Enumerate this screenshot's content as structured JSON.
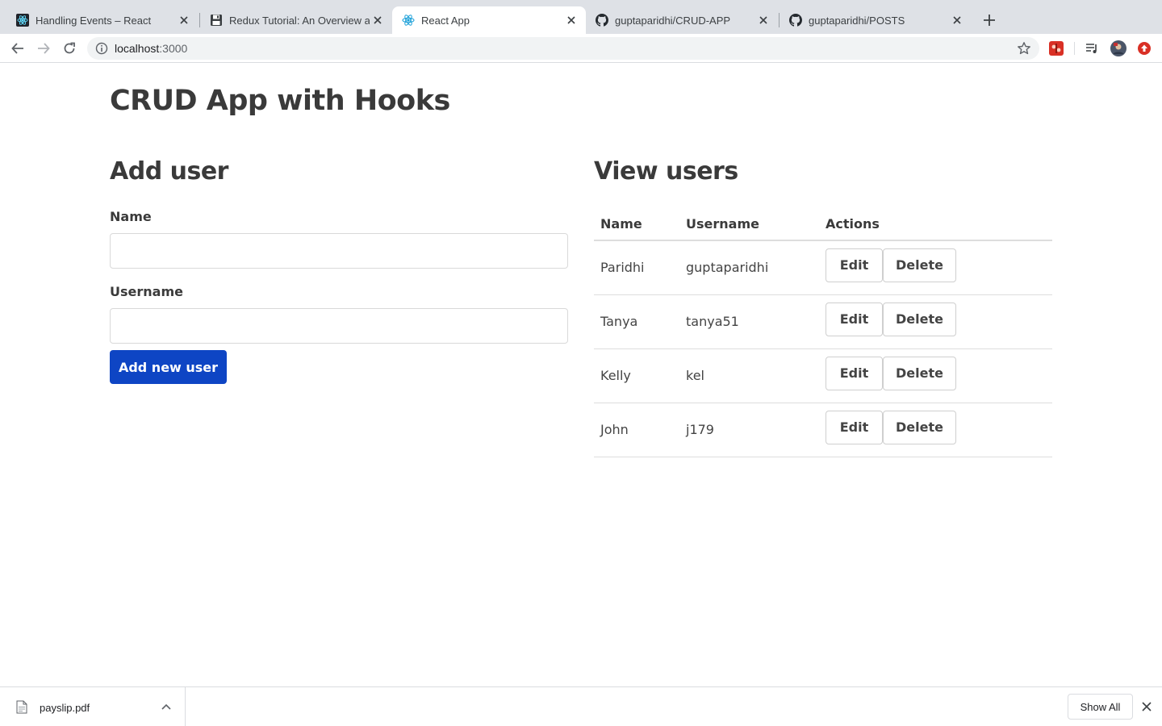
{
  "browser": {
    "tabs": [
      {
        "title": "Handling Events – React",
        "icon": "react-icon",
        "active": false
      },
      {
        "title": "Redux Tutorial: An Overview and",
        "icon": "floppy-disk-icon",
        "active": false
      },
      {
        "title": "React App",
        "icon": "react-icon",
        "active": true
      },
      {
        "title": "guptaparidhi/CRUD-APP",
        "icon": "github-icon",
        "active": false
      },
      {
        "title": "guptaparidhi/POSTS",
        "icon": "github-icon",
        "active": false
      }
    ],
    "url_host": "localhost",
    "url_port": ":3000"
  },
  "app": {
    "title": "CRUD App with Hooks",
    "add_section": {
      "heading": "Add user",
      "name_label": "Name",
      "name_value": "",
      "username_label": "Username",
      "username_value": "",
      "submit_label": "Add new user"
    },
    "view_section": {
      "heading": "View users",
      "columns": [
        "Name",
        "Username",
        "Actions"
      ],
      "rows": [
        {
          "name": "Paridhi",
          "username": "guptaparidhi"
        },
        {
          "name": "Tanya",
          "username": "tanya51"
        },
        {
          "name": "Kelly",
          "username": "kel"
        },
        {
          "name": "John",
          "username": "j179"
        }
      ],
      "edit_label": "Edit",
      "delete_label": "Delete"
    }
  },
  "downloads": {
    "file_name": "payslip.pdf",
    "show_all_label": "Show All"
  },
  "colors": {
    "primary_button": "#0e45c4",
    "tab_strip": "#dee1e6"
  }
}
